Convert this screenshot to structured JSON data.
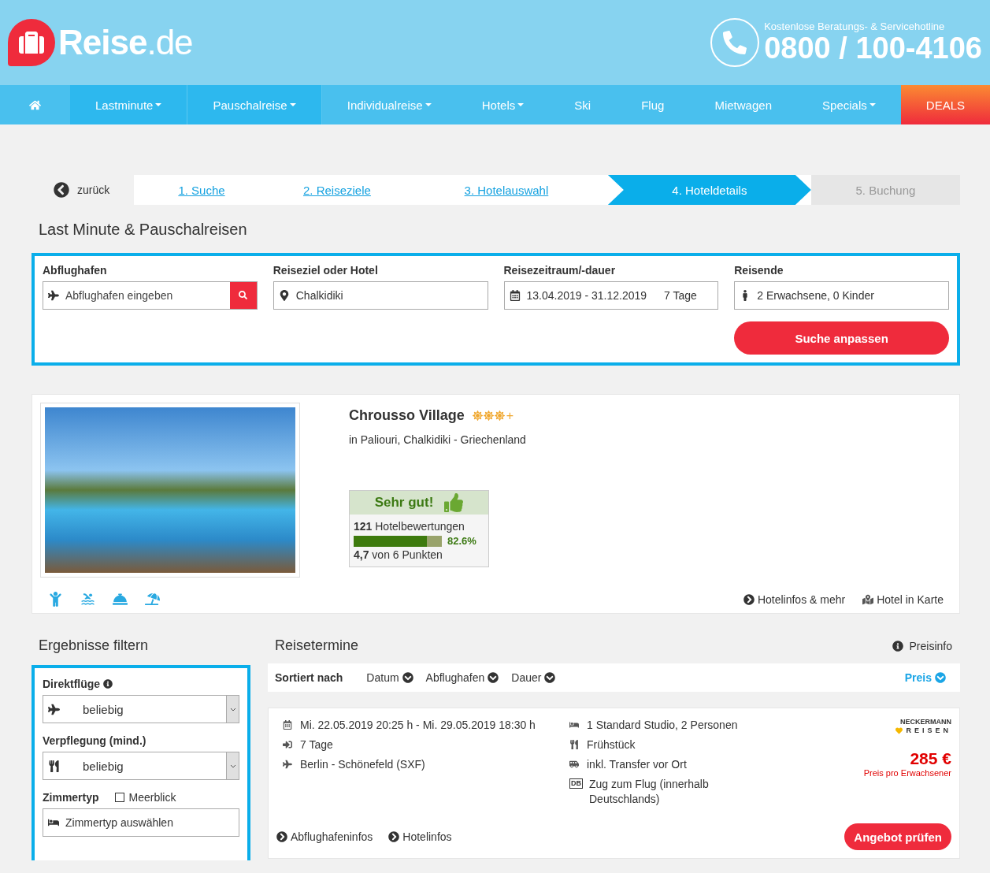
{
  "header": {
    "logo": "**Reise**.de",
    "hotline_label": "Kostenlose Beratungs- & Servicehotline",
    "hotline_number": "0800 / 100-4106"
  },
  "nav": [
    {
      "kind": "home"
    },
    {
      "kind": "menu",
      "label": "Lastminute",
      "dropdown": true,
      "highlighted": true
    },
    {
      "kind": "menu",
      "label": "Pauschalreise",
      "dropdown": true,
      "highlighted": true
    },
    {
      "kind": "menu",
      "label": "Individualreise",
      "dropdown": true,
      "highlighted": false
    },
    {
      "kind": "menu",
      "label": "Hotels",
      "dropdown": true,
      "highlighted": false
    },
    {
      "kind": "menu",
      "label": "Ski",
      "dropdown": false,
      "highlighted": false
    },
    {
      "kind": "menu",
      "label": "Flug",
      "dropdown": false,
      "highlighted": false
    },
    {
      "kind": "menu",
      "label": "Mietwagen",
      "dropdown": false,
      "highlighted": false
    },
    {
      "kind": "menu",
      "label": "Specials",
      "dropdown": true,
      "highlighted": false
    },
    {
      "kind": "deals",
      "label": "DEALS",
      "dropdown": false,
      "highlighted": false
    }
  ],
  "steps": {
    "back": "zurück",
    "items": [
      {
        "label": "1. Suche",
        "completed": true,
        "selected": false
      },
      {
        "label": "2. Reiseziele",
        "completed": true,
        "selected": false
      },
      {
        "label": "3. Hotelauswahl",
        "completed": true,
        "selected": false
      },
      {
        "label": "4. Hoteldetails",
        "completed": false,
        "selected": true
      },
      {
        "label": "5. Buchung",
        "completed": false,
        "selected": false
      }
    ]
  },
  "search": {
    "title": "Last Minute & Pauschalreisen",
    "fields": [
      {
        "kind": "airport",
        "label": "Abflughafen",
        "placeholder": "Abflughafen eingeben"
      },
      {
        "kind": "destination",
        "label": "Reiseziel oder Hotel",
        "value": "Chalkidiki"
      },
      {
        "kind": "dates",
        "label": "Reisezeitraum/-dauer",
        "value": "13.04.2019 - 31.12.2019",
        "extra": "7 Tage"
      },
      {
        "kind": "travellers",
        "label": "Reisende",
        "value": "2 Erwachsene, 0 Kinder"
      }
    ],
    "button": "Suche anpassen"
  },
  "hotel": {
    "name": "Chrousso Village",
    "stars": 3,
    "stars_suffix": "+",
    "location": "in Paliouri, Chalkidiki - Griechenland",
    "rating": {
      "label": "Sehr gut!",
      "reviews": "**121** Hotelbewertungen",
      "level": 0.826,
      "percent": "82.6%",
      "score": "**4,7** von 6 Punkten"
    },
    "links": [
      {
        "kind": "info",
        "label": "Hotelinfos & mehr"
      },
      {
        "kind": "map",
        "label": "Hotel in Karte"
      }
    ]
  },
  "filters": {
    "title": "Ergebnisse filtern",
    "groups": [
      {
        "kind": "flights",
        "label": "Direktflüge",
        "info": true,
        "value": "beliebig"
      },
      {
        "kind": "board",
        "label": "Verpflegung (mind.)",
        "info": false,
        "value": "beliebig"
      },
      {
        "kind": "room",
        "label": "Zimmertyp",
        "checkbox": {
          "label": "Meerblick",
          "checked": false
        },
        "placeholder": "Zimmertyp auswählen"
      }
    ]
  },
  "results": {
    "title": "Reisetermine",
    "price_info": "Preisinfo",
    "sort_label": "Sortiert nach",
    "sort": [
      {
        "label": "Datum",
        "selected": false
      },
      {
        "label": "Abflughafen",
        "selected": false
      },
      {
        "label": "Dauer",
        "selected": false
      },
      {
        "label": "Preis",
        "selected": true
      }
    ],
    "offers": [
      {
        "left": [
          {
            "kind": "date",
            "text": "Mi. 22.05.2019 20:25 h - Mi. 29.05.2019 18:30 h"
          },
          {
            "kind": "duration",
            "text": "7 Tage"
          },
          {
            "kind": "flight",
            "text": "Berlin - Schönefeld (SXF)"
          }
        ],
        "right": [
          {
            "kind": "room",
            "text": "1 Standard Studio, 2 Personen"
          },
          {
            "kind": "board",
            "text": "Frühstück"
          },
          {
            "kind": "transfer",
            "text": "inkl. Transfer vor Ort"
          },
          {
            "kind": "train",
            "badge": "DB",
            "text": "Zug zum Flug (innerhalb Deutschlands)"
          }
        ],
        "operator": {
          "name": "NECKERMANN",
          "sub": "REISEN"
        },
        "price": "285 €",
        "price_note": "Preis pro Erwachsener",
        "links": [
          "Abflughafeninfos",
          "Hotelinfos"
        ],
        "button": "Angebot prüfen"
      }
    ]
  }
}
